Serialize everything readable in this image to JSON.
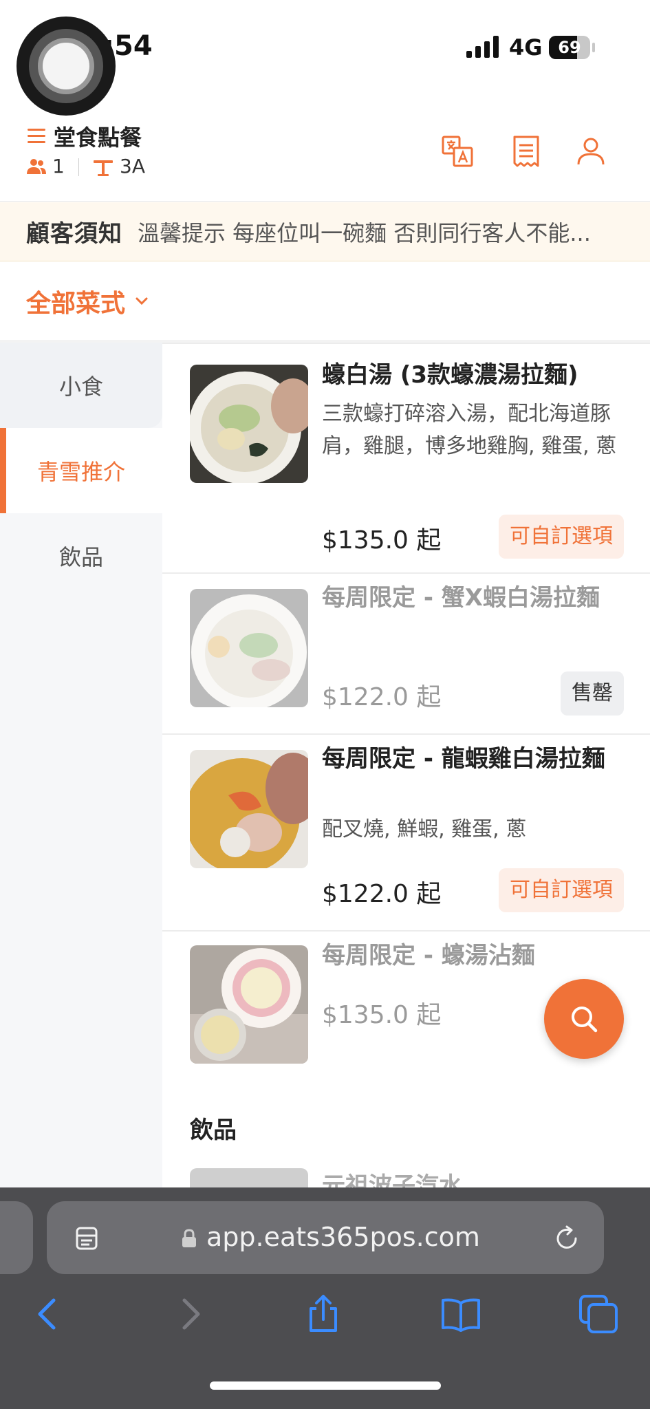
{
  "status_bar": {
    "time": ":54",
    "network": "4G",
    "battery_level": 69,
    "battery_label": "69"
  },
  "header": {
    "title": "堂食點餐",
    "guest_count": "1",
    "table_number": "3A"
  },
  "notice": {
    "label": "顧客須知",
    "text": "溫馨提示 每座位叫一碗麵 否則同行客人不能..."
  },
  "category_selector": {
    "label": "全部菜式"
  },
  "sidebar": {
    "items": [
      {
        "label": "小食"
      },
      {
        "label": "青雪推介"
      },
      {
        "label": "飲品"
      }
    ]
  },
  "menu": {
    "items": [
      {
        "name": "蠔白湯 (3款蠔濃湯拉麵)",
        "description": "三款蠔打碎溶入湯，配北海道豚肩，雞腿，博多地雞胸, 雞蛋, 蔥",
        "price": "$135.0 起",
        "badge": "可自訂選項"
      },
      {
        "name": "每周限定 - 蟹X蝦白湯拉麵",
        "price": "$122.0 起",
        "badge": "售罄"
      },
      {
        "name": "每周限定 - 龍蝦雞白湯拉麵",
        "description": "配叉燒, 鮮蝦, 雞蛋, 蔥",
        "price": "$122.0 起",
        "badge": "可自訂選項"
      },
      {
        "name": "每周限定 - 蠔湯沾麵",
        "price": "$135.0 起"
      }
    ],
    "next_section_title": "飲品",
    "next_item_partial": "元祖波子汽水"
  },
  "browser": {
    "url": "app.eats365pos.com"
  },
  "colors": {
    "accent": "#f07238",
    "browser_chrome": "#4d4d50",
    "ios_blue": "#3b8cff"
  },
  "icons": [
    "menu-icon",
    "guests-icon",
    "table-icon",
    "translate-icon",
    "receipt-icon",
    "user-icon",
    "chevron-down-icon",
    "search-icon",
    "reader-icon",
    "lock-icon",
    "reload-icon",
    "back-icon",
    "forward-icon",
    "share-icon",
    "bookmarks-icon",
    "tabs-icon"
  ]
}
